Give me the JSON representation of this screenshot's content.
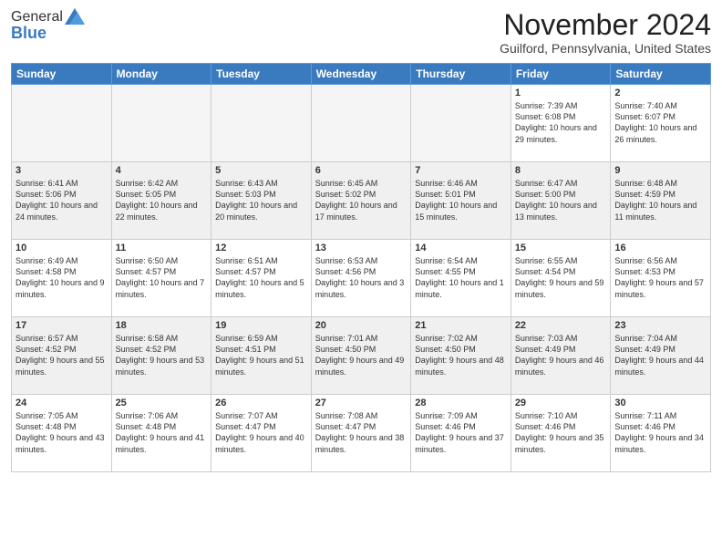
{
  "header": {
    "logo_general": "General",
    "logo_blue": "Blue",
    "month_title": "November 2024",
    "location": "Guilford, Pennsylvania, United States"
  },
  "weekdays": [
    "Sunday",
    "Monday",
    "Tuesday",
    "Wednesday",
    "Thursday",
    "Friday",
    "Saturday"
  ],
  "weeks": [
    [
      {
        "day": "",
        "info": ""
      },
      {
        "day": "",
        "info": ""
      },
      {
        "day": "",
        "info": ""
      },
      {
        "day": "",
        "info": ""
      },
      {
        "day": "",
        "info": ""
      },
      {
        "day": "1",
        "info": "Sunrise: 7:39 AM\nSunset: 6:08 PM\nDaylight: 10 hours and 29 minutes."
      },
      {
        "day": "2",
        "info": "Sunrise: 7:40 AM\nSunset: 6:07 PM\nDaylight: 10 hours and 26 minutes."
      }
    ],
    [
      {
        "day": "3",
        "info": "Sunrise: 6:41 AM\nSunset: 5:06 PM\nDaylight: 10 hours and 24 minutes."
      },
      {
        "day": "4",
        "info": "Sunrise: 6:42 AM\nSunset: 5:05 PM\nDaylight: 10 hours and 22 minutes."
      },
      {
        "day": "5",
        "info": "Sunrise: 6:43 AM\nSunset: 5:03 PM\nDaylight: 10 hours and 20 minutes."
      },
      {
        "day": "6",
        "info": "Sunrise: 6:45 AM\nSunset: 5:02 PM\nDaylight: 10 hours and 17 minutes."
      },
      {
        "day": "7",
        "info": "Sunrise: 6:46 AM\nSunset: 5:01 PM\nDaylight: 10 hours and 15 minutes."
      },
      {
        "day": "8",
        "info": "Sunrise: 6:47 AM\nSunset: 5:00 PM\nDaylight: 10 hours and 13 minutes."
      },
      {
        "day": "9",
        "info": "Sunrise: 6:48 AM\nSunset: 4:59 PM\nDaylight: 10 hours and 11 minutes."
      }
    ],
    [
      {
        "day": "10",
        "info": "Sunrise: 6:49 AM\nSunset: 4:58 PM\nDaylight: 10 hours and 9 minutes."
      },
      {
        "day": "11",
        "info": "Sunrise: 6:50 AM\nSunset: 4:57 PM\nDaylight: 10 hours and 7 minutes."
      },
      {
        "day": "12",
        "info": "Sunrise: 6:51 AM\nSunset: 4:57 PM\nDaylight: 10 hours and 5 minutes."
      },
      {
        "day": "13",
        "info": "Sunrise: 6:53 AM\nSunset: 4:56 PM\nDaylight: 10 hours and 3 minutes."
      },
      {
        "day": "14",
        "info": "Sunrise: 6:54 AM\nSunset: 4:55 PM\nDaylight: 10 hours and 1 minute."
      },
      {
        "day": "15",
        "info": "Sunrise: 6:55 AM\nSunset: 4:54 PM\nDaylight: 9 hours and 59 minutes."
      },
      {
        "day": "16",
        "info": "Sunrise: 6:56 AM\nSunset: 4:53 PM\nDaylight: 9 hours and 57 minutes."
      }
    ],
    [
      {
        "day": "17",
        "info": "Sunrise: 6:57 AM\nSunset: 4:52 PM\nDaylight: 9 hours and 55 minutes."
      },
      {
        "day": "18",
        "info": "Sunrise: 6:58 AM\nSunset: 4:52 PM\nDaylight: 9 hours and 53 minutes."
      },
      {
        "day": "19",
        "info": "Sunrise: 6:59 AM\nSunset: 4:51 PM\nDaylight: 9 hours and 51 minutes."
      },
      {
        "day": "20",
        "info": "Sunrise: 7:01 AM\nSunset: 4:50 PM\nDaylight: 9 hours and 49 minutes."
      },
      {
        "day": "21",
        "info": "Sunrise: 7:02 AM\nSunset: 4:50 PM\nDaylight: 9 hours and 48 minutes."
      },
      {
        "day": "22",
        "info": "Sunrise: 7:03 AM\nSunset: 4:49 PM\nDaylight: 9 hours and 46 minutes."
      },
      {
        "day": "23",
        "info": "Sunrise: 7:04 AM\nSunset: 4:49 PM\nDaylight: 9 hours and 44 minutes."
      }
    ],
    [
      {
        "day": "24",
        "info": "Sunrise: 7:05 AM\nSunset: 4:48 PM\nDaylight: 9 hours and 43 minutes."
      },
      {
        "day": "25",
        "info": "Sunrise: 7:06 AM\nSunset: 4:48 PM\nDaylight: 9 hours and 41 minutes."
      },
      {
        "day": "26",
        "info": "Sunrise: 7:07 AM\nSunset: 4:47 PM\nDaylight: 9 hours and 40 minutes."
      },
      {
        "day": "27",
        "info": "Sunrise: 7:08 AM\nSunset: 4:47 PM\nDaylight: 9 hours and 38 minutes."
      },
      {
        "day": "28",
        "info": "Sunrise: 7:09 AM\nSunset: 4:46 PM\nDaylight: 9 hours and 37 minutes."
      },
      {
        "day": "29",
        "info": "Sunrise: 7:10 AM\nSunset: 4:46 PM\nDaylight: 9 hours and 35 minutes."
      },
      {
        "day": "30",
        "info": "Sunrise: 7:11 AM\nSunset: 4:46 PM\nDaylight: 9 hours and 34 minutes."
      }
    ]
  ]
}
